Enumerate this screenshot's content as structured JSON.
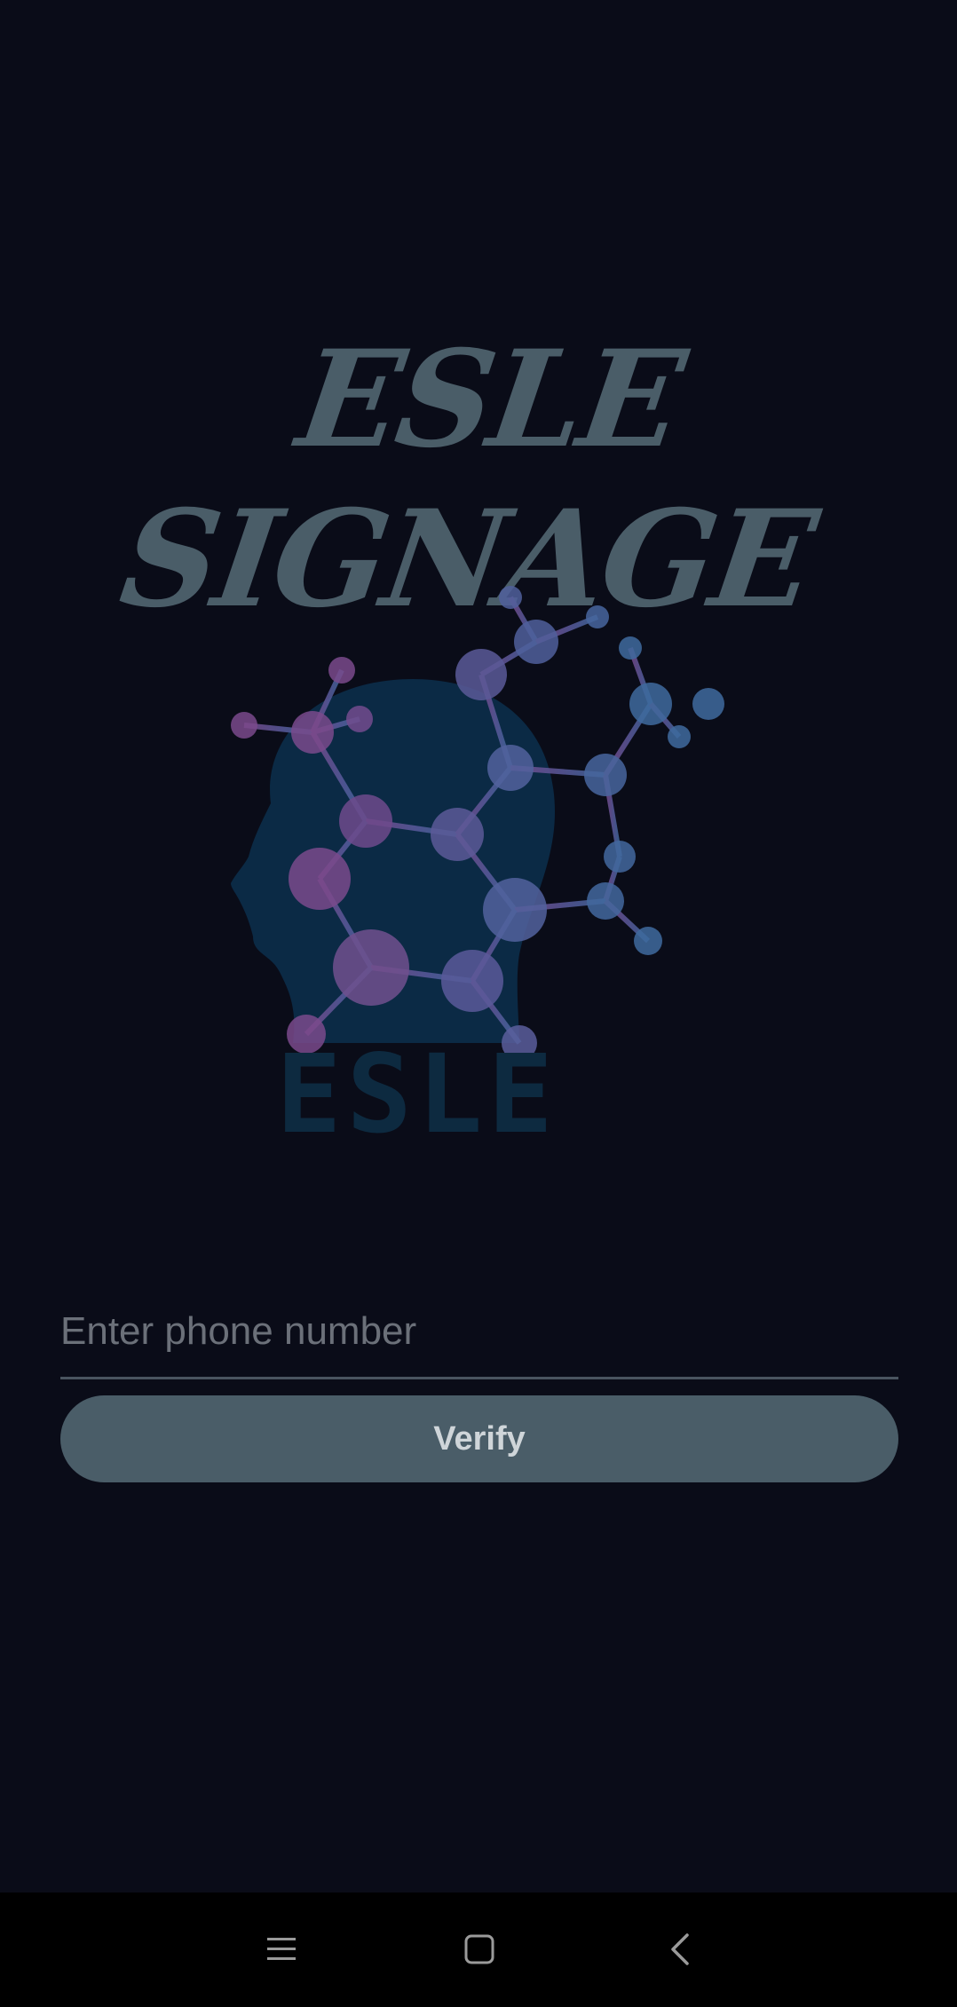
{
  "app": {
    "title": "ESLE SIGNAGE",
    "logo_text": "ESLE"
  },
  "login": {
    "phone_placeholder": "Enter phone number",
    "phone_value": "",
    "verify_label": "Verify"
  },
  "nav_bar": {
    "items": [
      "menu-icon",
      "home-icon",
      "back-icon"
    ]
  },
  "colors": {
    "background": "#0a0c18",
    "title": "#4a5d68",
    "button": "#4a5d68",
    "head_silhouette": "#0b2a45",
    "molecule_purple": "#7a4a8c",
    "molecule_blue": "#4a6a9e"
  }
}
